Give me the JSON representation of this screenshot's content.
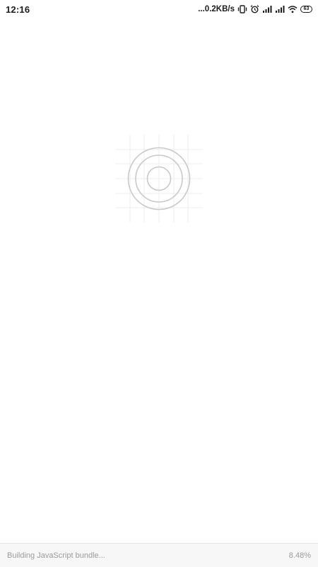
{
  "status_bar": {
    "time": "12:16",
    "network_speed": "...0.2KB/s",
    "battery_level": "63",
    "icons": [
      "vibrate-icon",
      "alarm-icon",
      "signal-icon",
      "signal-icon",
      "wifi-icon",
      "battery-icon"
    ]
  },
  "splash": {
    "icon": "react-native-placeholder-logo"
  },
  "bundle_bar": {
    "message": "Building JavaScript bundle...",
    "progress_text": "8.48%",
    "progress": 0.0848
  },
  "colors": {
    "background": "#ffffff",
    "bundle_bar_background": "#f7f7f7",
    "bundle_text": "#9b9b9b",
    "logo_stroke": "#c9c9c9",
    "grid_stroke": "#eeeeee"
  }
}
